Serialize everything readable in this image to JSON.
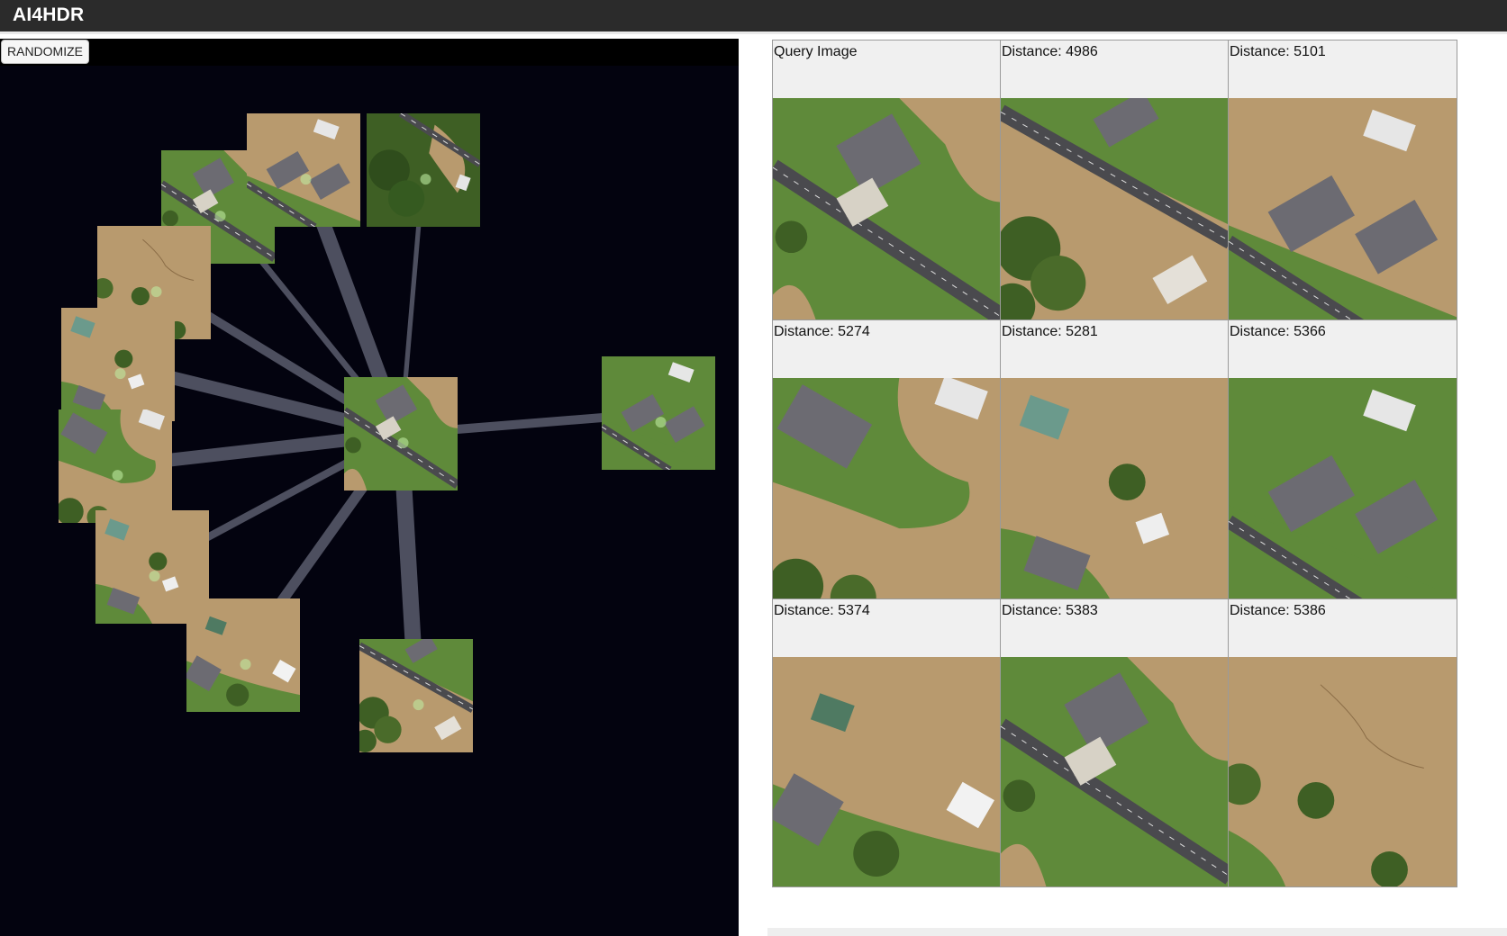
{
  "app": {
    "title": "AI4HDR"
  },
  "graph": {
    "randomize_label": "RANDOMIZE",
    "center_node": {
      "name": "query-node",
      "scene": "house-lawn-road"
    },
    "neighbor_nodes": [
      {
        "name": "neighbor-house-road-2",
        "scene": "house-lawn-road",
        "link_strength": 0.3
      },
      {
        "name": "neighbor-houses-flooded",
        "scene": "houses-flood",
        "link_strength": 0.9
      },
      {
        "name": "neighbor-trees-road",
        "scene": "trees-road",
        "link_strength": 0.2
      },
      {
        "name": "neighbor-flood-crack",
        "scene": "flood-crack",
        "link_strength": 0.5
      },
      {
        "name": "neighbor-gazebo-flood",
        "scene": "gazebo-flood",
        "link_strength": 0.8
      },
      {
        "name": "neighbor-island-flood",
        "scene": "island-flood",
        "link_strength": 0.8
      },
      {
        "name": "neighbor-shed-flood",
        "scene": "shed-flood",
        "link_strength": 0.4
      },
      {
        "name": "neighbor-yard-flood",
        "scene": "yard-flood",
        "link_strength": 0.6
      },
      {
        "name": "neighbor-road-flood",
        "scene": "road-flood",
        "link_strength": 1.0
      },
      {
        "name": "neighbor-houses-road-right",
        "scene": "houses-road",
        "link_strength": 0.5
      }
    ]
  },
  "results": [
    {
      "label": "Query Image",
      "scene": "house-lawn-road"
    },
    {
      "label": "Distance: 4986",
      "scene": "road-flood-trees"
    },
    {
      "label": "Distance: 5101",
      "scene": "houses-flood"
    },
    {
      "label": "Distance: 5274",
      "scene": "house-island-flood"
    },
    {
      "label": "Distance: 5281",
      "scene": "gazebo-flood"
    },
    {
      "label": "Distance: 5366",
      "scene": "houses-road"
    },
    {
      "label": "Distance: 5374",
      "scene": "shed-flood-yard"
    },
    {
      "label": "Distance: 5383",
      "scene": "house-lawn-road-2"
    },
    {
      "label": "Distance: 5386",
      "scene": "flood-crack"
    }
  ],
  "colors": {
    "topbar": "#2b2b2b",
    "graph_background": "#03030f",
    "flood_water": "#b89a6e",
    "grass": "#5f8a3a",
    "road": "#4a4a4e",
    "roof": "#6c6b72"
  }
}
